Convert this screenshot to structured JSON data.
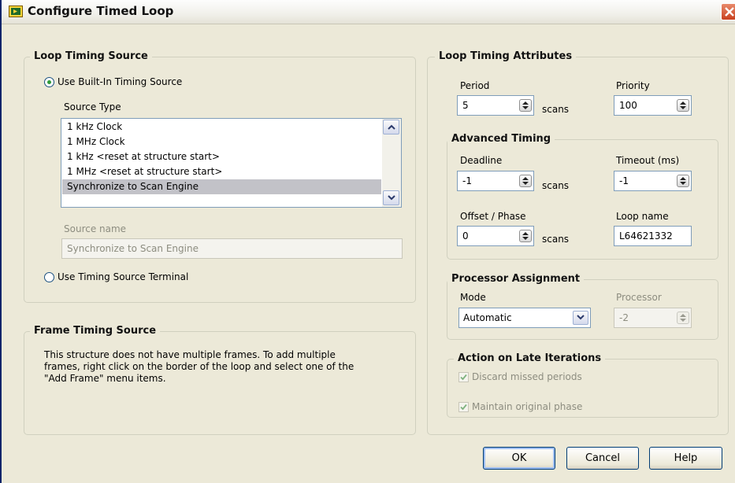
{
  "window": {
    "title": "Configure Timed Loop"
  },
  "loop_timing_source": {
    "legend": "Loop Timing Source",
    "builtin_radio_label": "Use Built-In Timing Source",
    "builtin_selected": true,
    "source_type_label": "Source Type",
    "source_types": [
      "1 kHz Clock",
      "1 MHz Clock",
      "1 kHz <reset at structure start>",
      "1 MHz <reset at structure start>",
      "Synchronize to Scan Engine"
    ],
    "selected_source": "Synchronize to Scan Engine",
    "source_name_label": "Source name",
    "source_name_value": "Synchronize to Scan Engine",
    "terminal_radio_label": "Use Timing Source Terminal",
    "terminal_selected": false
  },
  "frame_timing_source": {
    "legend": "Frame Timing Source",
    "message_lines": [
      "This structure does not have multiple frames. To add multiple",
      "frames, right click on the border of the loop and select one of the",
      "\"Add Frame\" menu items."
    ]
  },
  "loop_timing_attributes": {
    "legend": "Loop Timing Attributes",
    "period_label": "Period",
    "period_value": "5",
    "period_unit": "scans",
    "priority_label": "Priority",
    "priority_value": "100"
  },
  "advanced_timing": {
    "legend": "Advanced Timing",
    "deadline_label": "Deadline",
    "deadline_value": "-1",
    "deadline_unit": "scans",
    "timeout_label": "Timeout (ms)",
    "timeout_value": "-1",
    "offset_label": "Offset / Phase",
    "offset_value": "0",
    "offset_unit": "scans",
    "loop_name_label": "Loop name",
    "loop_name_value": "L64621332"
  },
  "processor_assignment": {
    "legend": "Processor Assignment",
    "mode_label": "Mode",
    "mode_value": "Automatic",
    "processor_label": "Processor",
    "processor_value": "-2"
  },
  "late_iterations": {
    "legend": "Action on Late Iterations",
    "discard_label": "Discard missed periods",
    "discard_checked": true,
    "maintain_label": "Maintain original phase",
    "maintain_checked": true
  },
  "buttons": {
    "ok": "OK",
    "cancel": "Cancel",
    "help": "Help"
  },
  "colors": {
    "dialog_bg": "#ece9d8",
    "selected_row": "#c2c2c8",
    "radio_dot": "#2f9a3a",
    "close_button": "#c9411f"
  }
}
